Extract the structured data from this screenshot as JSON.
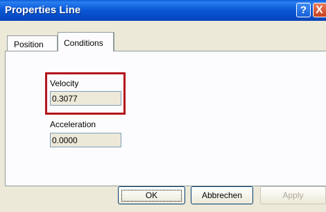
{
  "window": {
    "title": "Properties Line"
  },
  "title_buttons": {
    "help_glyph": "?",
    "close_glyph": "X"
  },
  "tabs": [
    {
      "label": "Position",
      "active": false
    },
    {
      "label": "Conditions",
      "active": true
    }
  ],
  "fields": {
    "velocity": {
      "label": "Velocity",
      "value": "0.3077"
    },
    "acceleration": {
      "label": "Acceleration",
      "value": "0.0000"
    }
  },
  "buttons": {
    "ok": "OK",
    "cancel": "Abbrechen",
    "apply": "Apply"
  },
  "colors": {
    "title_bar": "#0548c4",
    "highlight_border": "#b3141b",
    "dialog_bg": "#ece9d8"
  }
}
